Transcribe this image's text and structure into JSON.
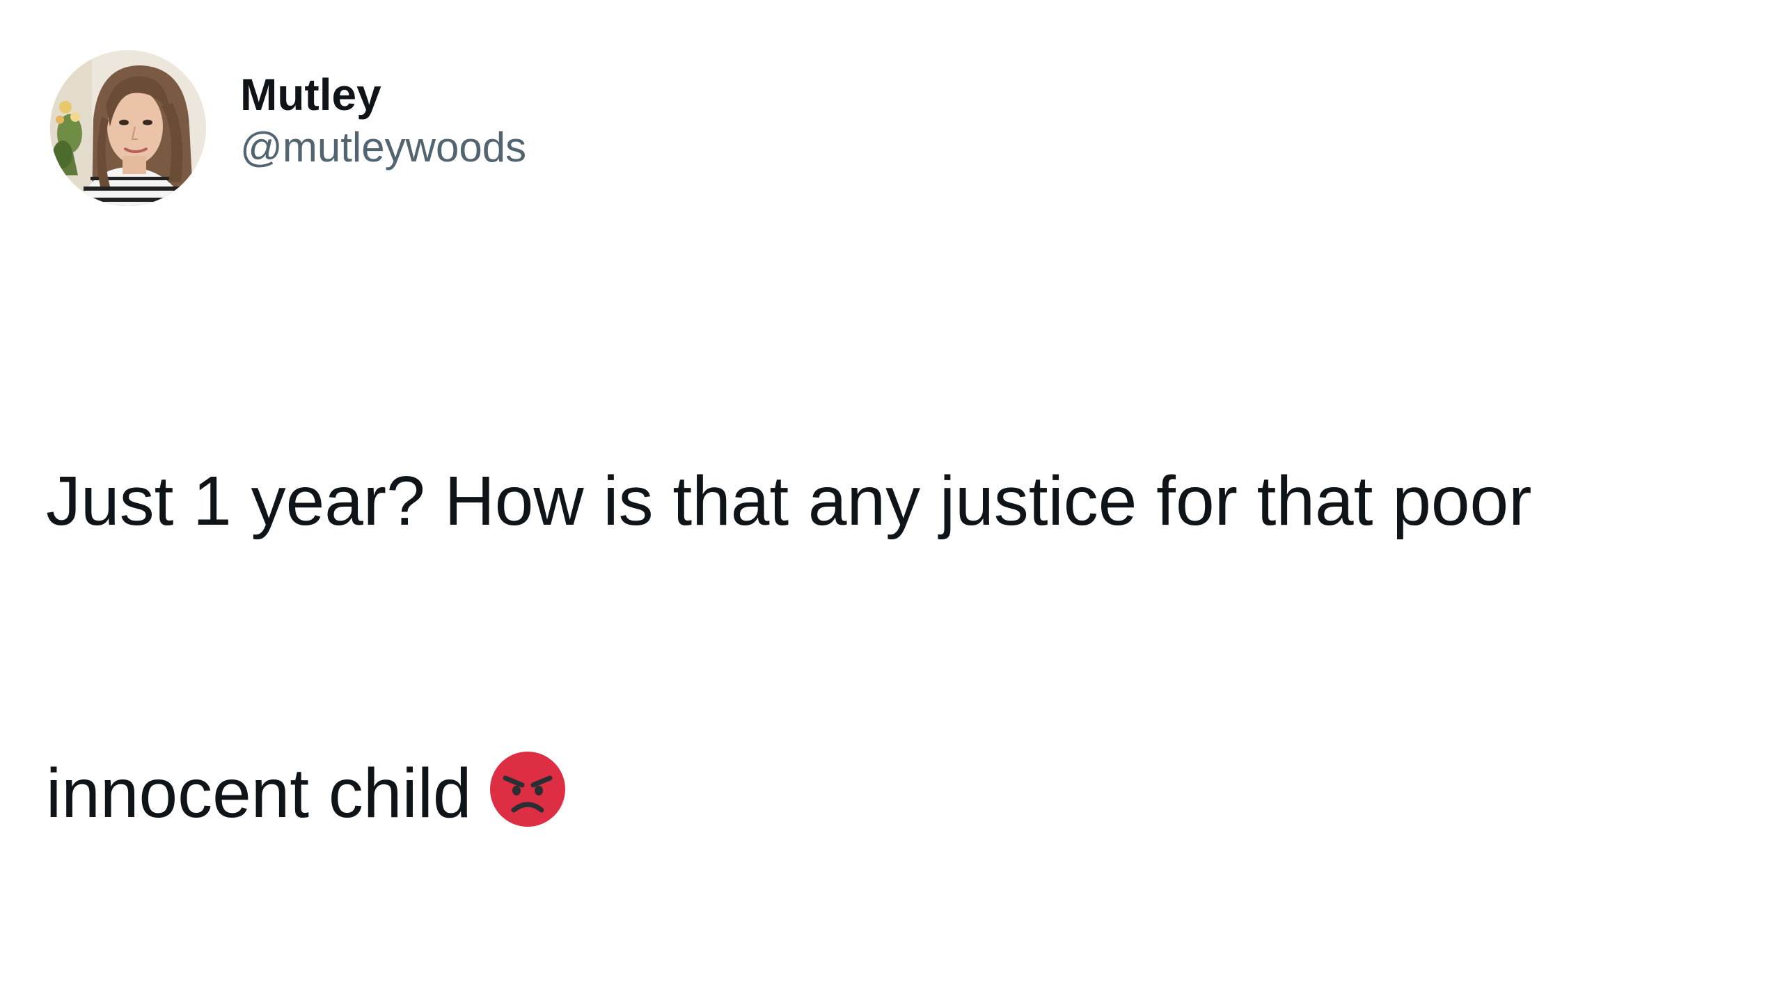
{
  "tweet": {
    "author": {
      "display_name": "Mutley",
      "handle": "@mutleywoods",
      "avatar_icon": "profile-photo"
    },
    "text_lines": [
      "Just 1 year? How is that any justice for that poor",
      "innocent child"
    ],
    "emoji": "angry-face-icon"
  },
  "colors": {
    "primary_text": "#0f1419",
    "secondary_text": "#536471",
    "emoji_red": "#dd2e44",
    "background": "#ffffff"
  }
}
